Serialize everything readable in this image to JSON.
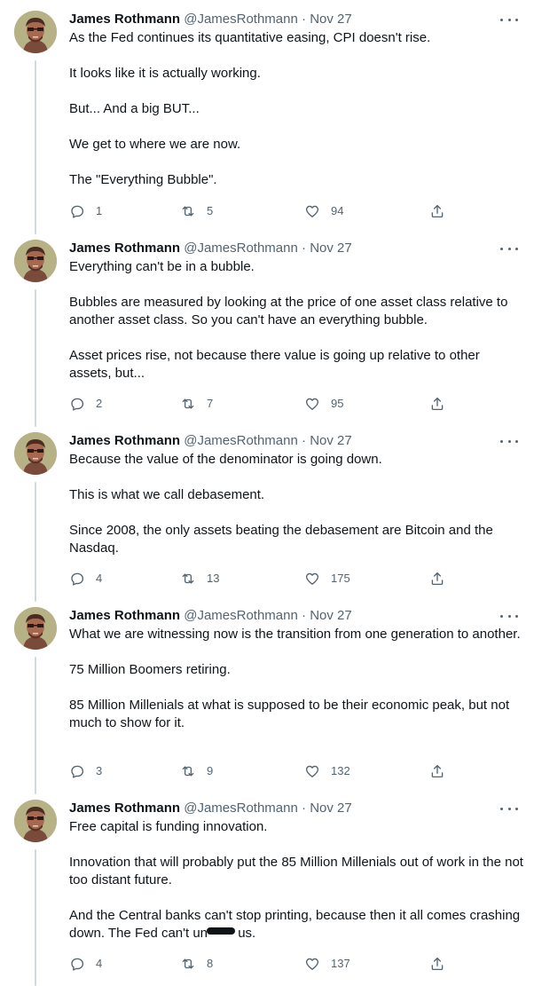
{
  "tweets": [
    {
      "name": "James Rothmann",
      "handle": "@JamesRothmann",
      "separator": "·",
      "date": "Nov 27",
      "paragraphs": [
        "As the Fed continues its quantitative easing, CPI doesn't rise.",
        "It looks like it is actually working.",
        "But... And a big BUT...",
        "We get to where we are now.",
        "The \"Everything Bubble\"."
      ],
      "replies": "1",
      "retweets": "5",
      "likes": "94"
    },
    {
      "name": "James Rothmann",
      "handle": "@JamesRothmann",
      "separator": "·",
      "date": "Nov 27",
      "paragraphs": [
        "Everything can't be in a bubble.",
        "Bubbles are measured by looking at the price of one asset class relative to another asset class. So you can't have an everything bubble.",
        "Asset prices rise, not because there value is going up relative to other assets, but..."
      ],
      "replies": "2",
      "retweets": "7",
      "likes": "95"
    },
    {
      "name": "James Rothmann",
      "handle": "@JamesRothmann",
      "separator": "·",
      "date": "Nov 27",
      "paragraphs": [
        "Because the value of the denominator is going down.",
        "This is what we call debasement.",
        "Since 2008, the only assets beating the debasement are Bitcoin and the Nasdaq."
      ],
      "replies": "4",
      "retweets": "13",
      "likes": "175"
    },
    {
      "name": "James Rothmann",
      "handle": "@JamesRothmann",
      "separator": "·",
      "date": "Nov 27",
      "paragraphs": [
        "What we are witnessing now is the transition from one generation to another.",
        "75 Million Boomers retiring.",
        "85 Million Millenials at what is supposed to be their economic peak, but not much to show for it."
      ],
      "replies": "3",
      "retweets": "9",
      "likes": "132"
    },
    {
      "name": "James Rothmann",
      "handle": "@JamesRothmann",
      "separator": "·",
      "date": "Nov 27",
      "paragraphs": [
        "Free capital is funding innovation.",
        "Innovation that will probably put the 85 Million Millenials out of work in the not too distant future."
      ],
      "last_paragraph_before": "And the Central banks can't stop printing, because then it all comes crashing down. The Fed can't un",
      "last_paragraph_after": " us.",
      "replies": "4",
      "retweets": "8",
      "likes": "137"
    }
  ],
  "icons": {
    "reply": "reply-icon",
    "retweet": "retweet-icon",
    "like": "heart-icon",
    "share": "share-icon",
    "more": "more-dots-icon"
  },
  "colors": {
    "text": "#0f1419",
    "secondary": "#536471",
    "thread_line": "#cfd9de"
  }
}
